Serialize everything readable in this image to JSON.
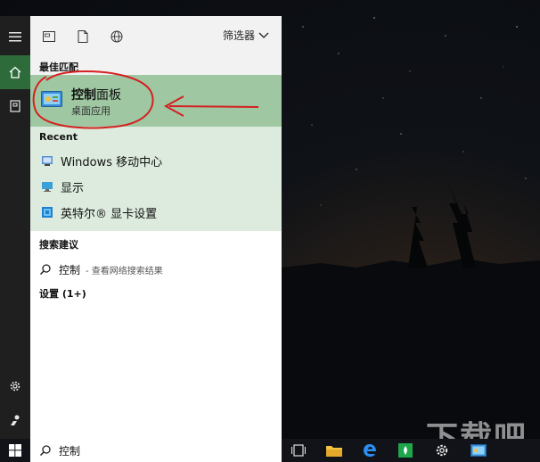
{
  "toolbar": {
    "filter_label": "筛选器"
  },
  "best_match": {
    "section_title": "最佳匹配",
    "title_highlight": "控制",
    "title_rest": "面板",
    "subtitle": "桌面应用"
  },
  "recent": {
    "section_title": "Recent",
    "items": [
      {
        "label": "Windows 移动中心",
        "icon": "mobility-center-icon"
      },
      {
        "label": "显示",
        "icon": "display-icon"
      },
      {
        "label": "英特尔® 显卡设置",
        "icon": "intel-graphics-icon"
      }
    ]
  },
  "suggestions": {
    "section_title": "搜索建议",
    "query": "控制",
    "hint": "- 查看网络搜索结果"
  },
  "settings": {
    "section_title": "设置 (1+)"
  },
  "search": {
    "value": "控制"
  },
  "watermark": "下载吧",
  "colors": {
    "best_match_bg": "#9ec7a2",
    "recent_bg": "#dcebdd",
    "rail_active": "#2d6b3a",
    "annotation": "#d42020"
  }
}
